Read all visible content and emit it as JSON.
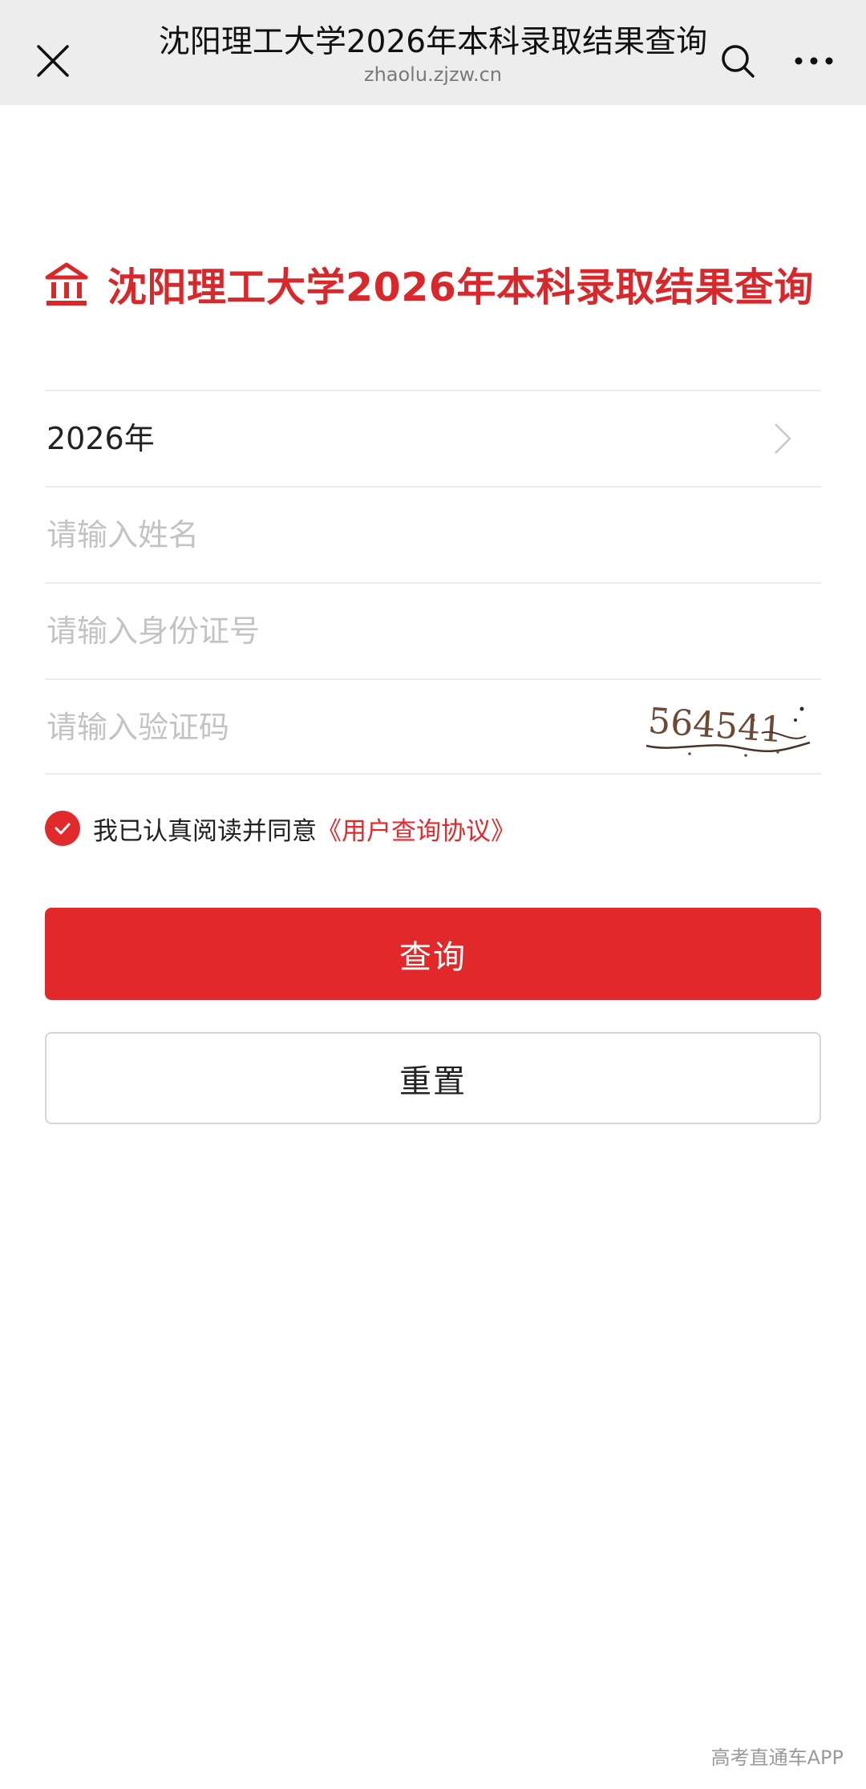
{
  "browser": {
    "title": "沈阳理工大学2026年本科录取结果查询",
    "domain": "zhaolu.zjzw.cn"
  },
  "page": {
    "heading": "沈阳理工大学2026年本科录取结果查询",
    "year_value": "2026年",
    "name_placeholder": "请输入姓名",
    "id_placeholder": "请输入身份证号",
    "captcha_placeholder": "请输入验证码",
    "captcha_code": "564541",
    "agree_text": "我已认真阅读并同意",
    "agree_link": "《用户查询协议》",
    "query_button": "查询",
    "reset_button": "重置"
  },
  "watermark": "高考直通车APP",
  "colors": {
    "accent": "#e1282a",
    "topbar": "#ededed"
  }
}
